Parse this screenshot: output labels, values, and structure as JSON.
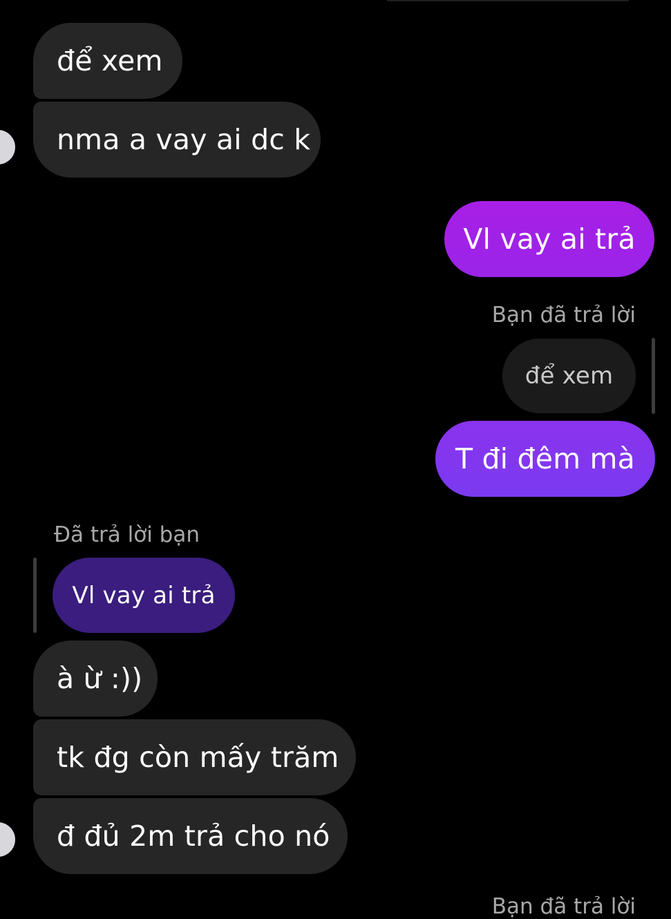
{
  "conversation": {
    "messages": [
      {
        "id": "m1",
        "direction": "incoming",
        "text": "để xem"
      },
      {
        "id": "m2",
        "direction": "incoming",
        "text": "nma a vay ai dc k"
      },
      {
        "id": "m3",
        "direction": "outgoing",
        "text": "Vl vay ai trả"
      },
      {
        "id": "m4",
        "direction": "outgoing",
        "reply_label": "Bạn đã trả lời",
        "quoted_text": "để xem",
        "text": "T đi đêm mà"
      },
      {
        "id": "m5",
        "direction": "incoming",
        "reply_label": "Đã trả lời bạn",
        "quoted_text": "Vl vay ai trả",
        "text": "à ừ :))"
      },
      {
        "id": "m6",
        "direction": "incoming",
        "text": "tk đg còn mấy trăm"
      },
      {
        "id": "m7",
        "direction": "incoming",
        "text": "đ đủ 2m trả cho nó"
      },
      {
        "id": "m8",
        "direction": "outgoing",
        "reply_label": "Bạn đã trả lời"
      }
    ]
  },
  "colors": {
    "background": "#000000",
    "incoming_bubble": "#262626",
    "outgoing_gradient_top": "#a81fe6",
    "outgoing_gradient_bottom": "#7a3af0",
    "quoted_outgoing_bubble": "#3a1d7e",
    "quoted_incoming_bubble": "#1b1b1b",
    "secondary_text": "#a8a8a8"
  },
  "icons": {
    "contact_avatar": "avatar-icon"
  }
}
